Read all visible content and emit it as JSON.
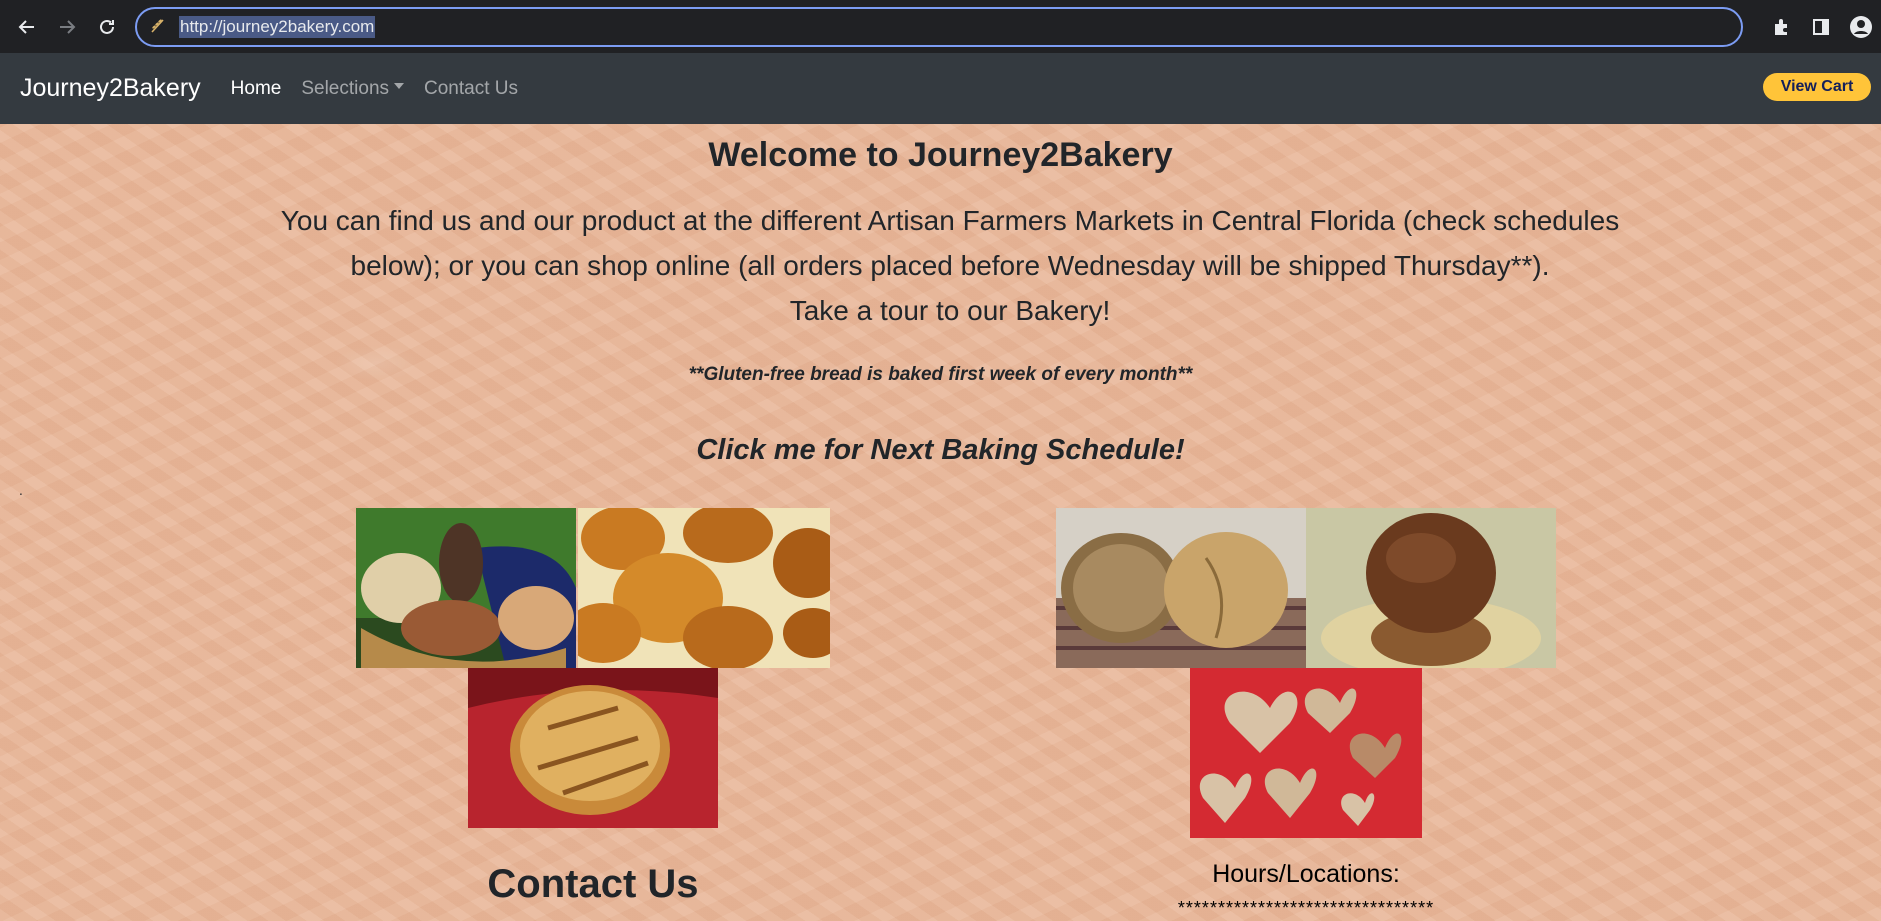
{
  "browser": {
    "url": "http://journey2bakery.com",
    "site_icon": "wheat-icon",
    "back_icon": "arrow-left-icon",
    "forward_icon": "arrow-right-icon",
    "reload_icon": "reload-icon"
  },
  "navbar": {
    "brand": "Journey2Bakery",
    "links": {
      "home": "Home",
      "selections": "Selections",
      "contact": "Contact Us"
    },
    "cart_label": "View Cart"
  },
  "main": {
    "welcome": "Welcome to Journey2Bakery",
    "intro_line1": "You can find us and our product at the different Artisan Farmers Markets in Central Florida (check schedules",
    "intro_line2": "below); or you can shop online (all orders placed before Wednesday will be shipped Thursday**).",
    "intro_line3": "Take a tour to our Bakery!",
    "gluten_note": "**Gluten-free bread is baked first week of every month**",
    "schedule_link": "Click me for Next Baking Schedule!",
    "dot": "."
  },
  "sections": {
    "contact_title": "Contact Us",
    "hours_title": "Hours/Locations:",
    "stars": "********************************"
  },
  "colors": {
    "navbar": "#343a40",
    "background": "#e9b89a",
    "cart_button": "#ffc439"
  }
}
